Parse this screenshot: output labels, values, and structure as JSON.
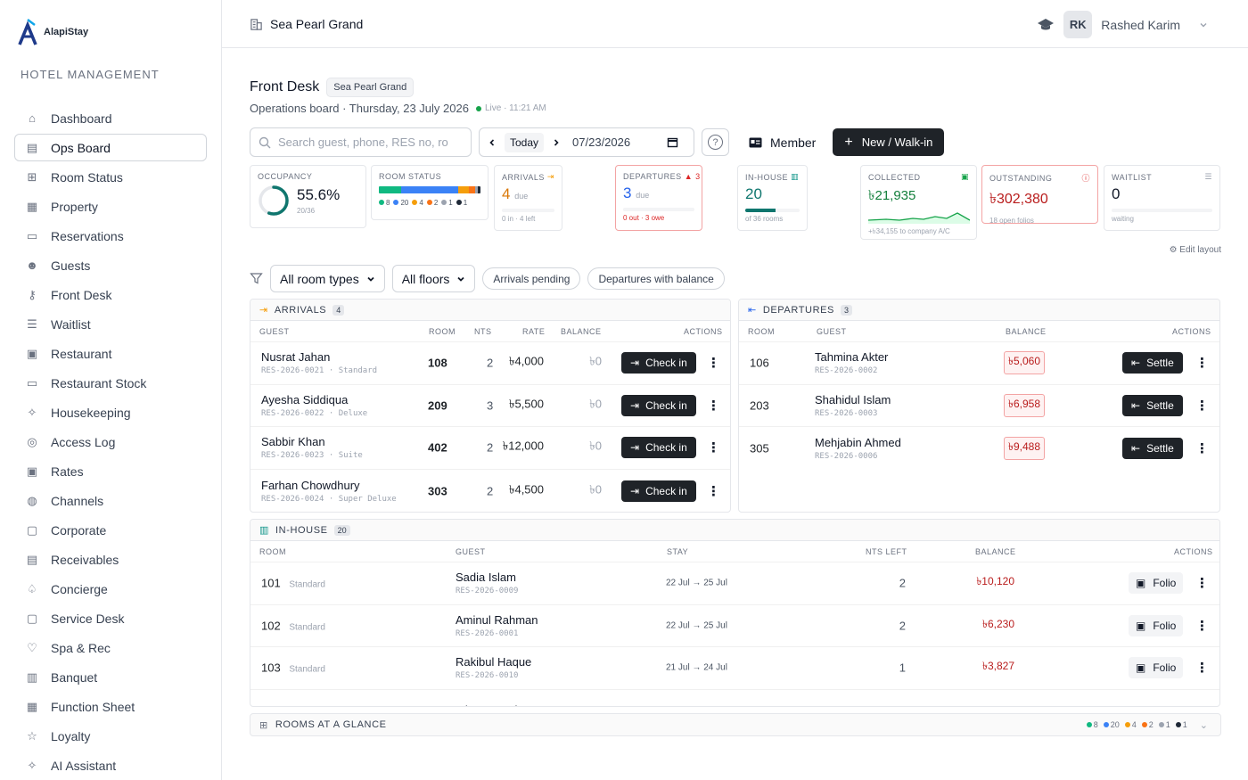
{
  "brand": {
    "name": "AlapiStay",
    "subtitle": "HOTEL MANAGEMENT"
  },
  "sidebar": {
    "items": [
      {
        "label": "Dashboard",
        "icon": "home-icon"
      },
      {
        "label": "Ops Board",
        "icon": "board-icon",
        "active": true
      },
      {
        "label": "Room Status",
        "icon": "grid-icon"
      },
      {
        "label": "Property",
        "icon": "building-icon"
      },
      {
        "label": "Reservations",
        "icon": "calendar-icon"
      },
      {
        "label": "Guests",
        "icon": "users-icon"
      },
      {
        "label": "Front Desk",
        "icon": "key-icon"
      },
      {
        "label": "Waitlist",
        "icon": "list-icon"
      },
      {
        "label": "Restaurant",
        "icon": "restaurant-icon"
      },
      {
        "label": "Restaurant Stock",
        "icon": "box-icon"
      },
      {
        "label": "Housekeeping",
        "icon": "sparkle-icon"
      },
      {
        "label": "Access Log",
        "icon": "fingerprint-icon"
      },
      {
        "label": "Rates",
        "icon": "money-icon"
      },
      {
        "label": "Channels",
        "icon": "globe-icon"
      },
      {
        "label": "Corporate",
        "icon": "briefcase-icon"
      },
      {
        "label": "Receivables",
        "icon": "receipt-icon"
      },
      {
        "label": "Concierge",
        "icon": "bell-icon"
      },
      {
        "label": "Service Desk",
        "icon": "bag-icon"
      },
      {
        "label": "Spa & Rec",
        "icon": "heart-icon"
      },
      {
        "label": "Banquet",
        "icon": "banquet-icon"
      },
      {
        "label": "Function Sheet",
        "icon": "sheet-icon"
      },
      {
        "label": "Loyalty",
        "icon": "star-icon"
      },
      {
        "label": "AI Assistant",
        "icon": "ai-sparkle-icon"
      }
    ]
  },
  "topbar": {
    "property": "Sea Pearl Grand",
    "user_initials": "RK",
    "user_name": "Rashed Karim"
  },
  "page": {
    "title": "Front Desk",
    "property_chip": "Sea Pearl Grand",
    "subtitle": "Operations board · Thursday, 23 July 2026",
    "live_label": "Live · 11:21 AM"
  },
  "toolbar": {
    "search_placeholder": "Search guest, phone, RES no, ro",
    "today_label": "Today",
    "date_value": "07/23/2026",
    "help_label": "?",
    "member_label": "Member",
    "new_label": "New / Walk-in"
  },
  "kpis": {
    "occupancy": {
      "label": "OCCUPANCY",
      "value": "55.6%",
      "foot": "20/36",
      "fraction": 0.556
    },
    "room_status": {
      "label": "ROOM STATUS",
      "legend": [
        {
          "count": "8",
          "color": "#10b981",
          "share": 8
        },
        {
          "count": "20",
          "color": "#3b82f6",
          "share": 20
        },
        {
          "count": "4",
          "color": "#f59e0b",
          "share": 4
        },
        {
          "count": "2",
          "color": "#f97316",
          "share": 2
        },
        {
          "count": "1",
          "color": "#9ca3af",
          "share": 1
        },
        {
          "count": "1",
          "color": "#1f2937",
          "share": 1
        }
      ]
    },
    "arrivals": {
      "label": "ARRIVALS",
      "value": "4",
      "unit": "due",
      "foot": "0 in · 4 left"
    },
    "departures": {
      "label": "DEPARTURES",
      "badge": "3",
      "value": "3",
      "unit": "due",
      "foot": "0 out · 3 owe"
    },
    "in_house": {
      "label": "IN-HOUSE",
      "value": "20",
      "foot": "of 36 rooms",
      "fraction": 0.556
    },
    "collected": {
      "label": "COLLECTED",
      "value": "৳21,935",
      "foot": "+৳34,155 to company A/C"
    },
    "outstanding": {
      "label": "OUTSTANDING",
      "value": "৳302,380",
      "foot": "18 open folios"
    },
    "waitlist": {
      "label": "WAITLIST",
      "value": "0",
      "foot": "waiting"
    }
  },
  "edit_layout": "⚙ Edit layout",
  "filters": {
    "room_types": "All room types",
    "floors": "All floors",
    "pill1": "Arrivals pending",
    "pill2": "Departures with balance"
  },
  "arrivals": {
    "title": "ARRIVALS",
    "count": "4",
    "headers": {
      "guest": "GUEST",
      "room": "ROOM",
      "nts": "NTS",
      "rate": "RATE",
      "balance": "BALANCE",
      "actions": "ACTIONS"
    },
    "action_label": "Check in",
    "rows": [
      {
        "name": "Nusrat Jahan",
        "res": "RES-2026-0021 · Standard",
        "room": "108",
        "nts": "2",
        "rate": "৳4,000",
        "balance": "৳0"
      },
      {
        "name": "Ayesha Siddiqua",
        "res": "RES-2026-0022 · Deluxe",
        "room": "209",
        "nts": "3",
        "rate": "৳5,500",
        "balance": "৳0"
      },
      {
        "name": "Sabbir Khan",
        "res": "RES-2026-0023 · Suite",
        "room": "402",
        "nts": "2",
        "rate": "৳12,000",
        "balance": "৳0"
      },
      {
        "name": "Farhan Chowdhury",
        "res": "RES-2026-0024 · Super Deluxe",
        "room": "303",
        "nts": "2",
        "rate": "৳4,500",
        "balance": "৳0"
      }
    ]
  },
  "departures": {
    "title": "DEPARTURES",
    "count": "3",
    "headers": {
      "room": "ROOM",
      "guest": "GUEST",
      "balance": "BALANCE",
      "actions": "ACTIONS"
    },
    "action_label": "Settle",
    "rows": [
      {
        "room": "106",
        "name": "Tahmina Akter",
        "res": "RES-2026-0002",
        "balance": "৳5,060"
      },
      {
        "room": "203",
        "name": "Shahidul Islam",
        "res": "RES-2026-0003",
        "balance": "৳6,958"
      },
      {
        "room": "305",
        "name": "Mehjabin Ahmed",
        "res": "RES-2026-0006",
        "balance": "৳9,488"
      }
    ]
  },
  "in_house": {
    "title": "IN-HOUSE",
    "count": "20",
    "headers": {
      "room": "ROOM",
      "guest": "GUEST",
      "stay": "STAY",
      "nts_left": "NTS LEFT",
      "balance": "BALANCE",
      "actions": "ACTIONS"
    },
    "action_label": "Folio",
    "rows": [
      {
        "room": "101",
        "type": "Standard",
        "name": "Sadia Islam",
        "res": "RES-2026-0009",
        "stay": "22 Jul → 25 Jul",
        "nts_left": "2",
        "balance": "৳10,120"
      },
      {
        "room": "102",
        "type": "Standard",
        "name": "Aminul Rahman",
        "res": "RES-2026-0001",
        "stay": "22 Jul → 25 Jul",
        "nts_left": "2",
        "balance": "৳6,230"
      },
      {
        "room": "103",
        "type": "Standard",
        "name": "Rakibul Haque",
        "res": "RES-2026-0010",
        "stay": "21 Jul → 24 Jul",
        "nts_left": "1",
        "balance": "৳3,827"
      },
      {
        "room": "",
        "type": "",
        "name": "Mizanur Rahman",
        "res": "",
        "stay": "",
        "nts_left": "",
        "balance": ""
      }
    ]
  },
  "glance": {
    "title": "ROOMS AT A GLANCE"
  }
}
